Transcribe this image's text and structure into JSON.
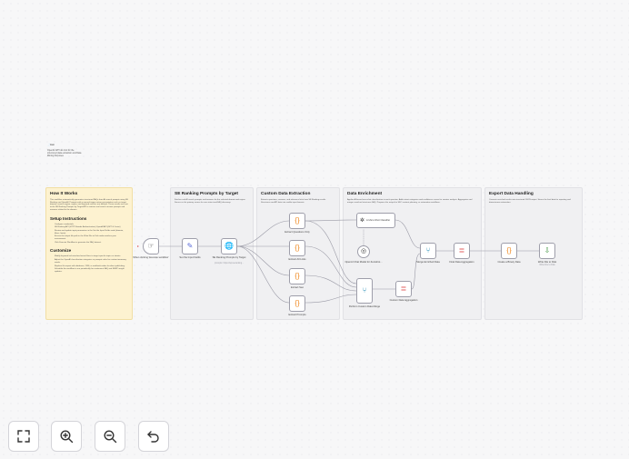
{
  "mini_note": {
    "title": "📄Lien",
    "body": "OpenAI GPT-4o mini for the structured data extraction and Data Mining Purposes"
  },
  "sticky_how": {
    "title": "How It Works",
    "intro": "This workflow automatically generates structured FAQs from AI search prompts using SE Ranking and OpenAI. Prompts with a manual trigger return presentation such as target domain, search engine, region, and keyword sources are defined. These results are sent to the SE Ranking Prompts by Target API to retrieve real search answer prompts and answers related to the domain.",
    "setup_title": "Setup Instructions",
    "setup_items": [
      "Configure credentials:",
      "SE Ranking API (HTTP Header Authentication) OpenAI API (GPT-4.1-mini)",
      "Review and update input parameters in the Set the Input Fields node (domain, filters, limits).",
      "Ensure the output file path in the Write File to Disk node matches your environment.",
      "Click Execute Workflow to generate the FAQ dataset."
    ],
    "custom_title": "Customize",
    "custom_items": [
      "Modify keyword inclusion/exclusion filters to target specific topics or intents.",
      "Adjust the OpenAI classification categories or prompts rules for custom taxonomy needs.",
      "Replace file export with database, CMS, or webhook nodes for direct publishing.",
      "Schedule the workflow to run periodically for continuous FAQ and SERP insight updates."
    ]
  },
  "sticky_prompts": {
    "title": "SE Ranking Prompts by Target",
    "body": "Fetches real AI search prompts and answers for the selected domain and region. Serves as the primary source for user intent and FAQ discovery."
  },
  "sticky_extract": {
    "title": "Custom Data Extraction",
    "body": "Extracts questions, answers, and reference links from SE Ranking results. Structures raw API data into usable input formats."
  },
  "sticky_enrich": {
    "title": "Data Enrichment",
    "body": "Applies AI-based zero-shot classification to each question. Adds intent categories and confidence scores for smarter analysis. Aggregates and merges enriched structures FAQ. Prepares the output for SEO content planning, or automation workflows."
  },
  "sticky_export": {
    "title": "Export Data Handling",
    "body": "Converts enriched results into structured JSON output. Stores the final data for reporting and downstream automation."
  },
  "nodes": {
    "trigger": {
      "label": "When clicking 'Execute workflow'",
      "icon": "cursor-icon"
    },
    "set_input": {
      "label": "Set the Input Fields",
      "icon": "pencil-icon"
    },
    "se_ranking": {
      "label": "SE Ranking Prompts by Target",
      "sub": "prompts: https://api.seranking..."
    },
    "extract_questions": {
      "label": "Extract Questions Only"
    },
    "extract_links": {
      "label": "Extract All Links"
    },
    "extract_seo": {
      "label": "Extract Seo"
    },
    "extract_prompts": {
      "label": "Extract Prompts"
    },
    "classifier": {
      "label": "AI Zero-Shot Classifier",
      "sub": "Classifier"
    },
    "chat_model": {
      "label": "OpenAI Chat Model for Zeroshot..."
    },
    "merge_custom": {
      "label": "Perform Custom Data Merge"
    },
    "custom_agg": {
      "label": "Custom Data Aggregation"
    },
    "merge_enriched": {
      "label": "Merge Enriched Data"
    },
    "final_agg": {
      "label": "Final Data Aggregation"
    },
    "binary": {
      "label": "Create a Binary Data"
    },
    "write_file": {
      "label": "Write File to Disk",
      "sub": "Write File to Disk"
    }
  },
  "controls": {
    "fit": "fit-view-icon",
    "zoom_in": "zoom-in-icon",
    "zoom_out": "zoom-out-icon",
    "undo": "undo-icon"
  }
}
